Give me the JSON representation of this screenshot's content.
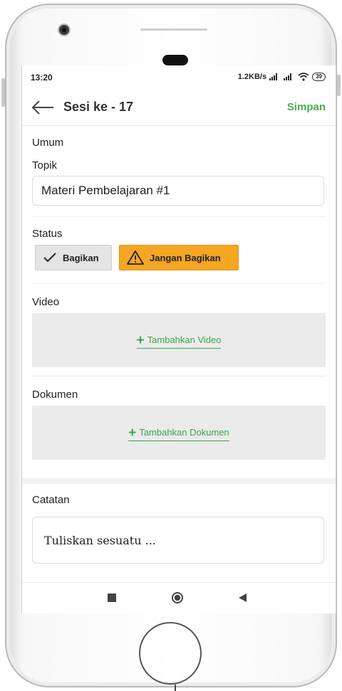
{
  "status_bar": {
    "time": "13:20",
    "network_speed": "1.2KB/s",
    "battery": "39"
  },
  "app_bar": {
    "back_icon": "arrow-left-icon",
    "title": "Sesi ke - 17",
    "save_label": "Simpan",
    "accent": "#4caf50"
  },
  "form": {
    "section_general": "Umum",
    "topic_label": "Topik",
    "topic_value": "Materi Pembelajaran #1",
    "status_label": "Status",
    "status_options": [
      {
        "label": "Bagikan",
        "icon": "check-icon",
        "color": "#e4e4e4"
      },
      {
        "label": "Jangan Bagikan",
        "icon": "warning-icon",
        "color": "#f5a623",
        "selected": true
      }
    ],
    "video_label": "Video",
    "add_video_label": "Tambahkan Video",
    "document_label": "Dokumen",
    "add_document_label": "Tambahkan Dokumen",
    "notes_label": "Catatan",
    "notes_placeholder": "Tuliskan sesuatu ..."
  },
  "nav_bar": {
    "icons": [
      "square-icon",
      "circle-icon",
      "triangle-back-icon"
    ]
  }
}
